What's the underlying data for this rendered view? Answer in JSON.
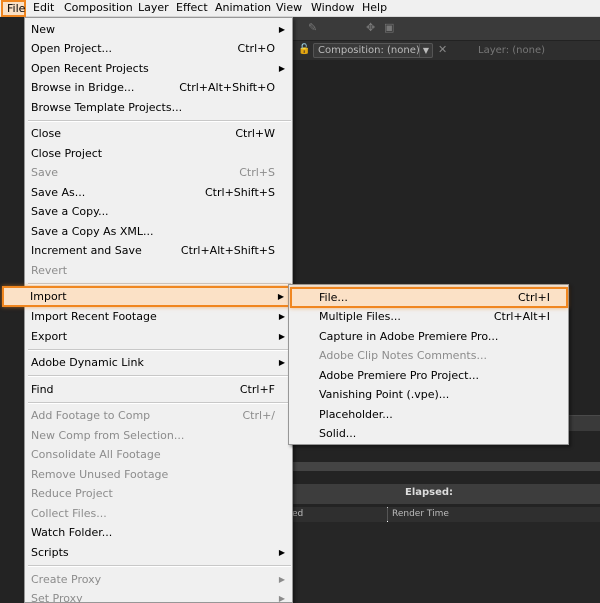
{
  "menubar": {
    "items": [
      "File",
      "Edit",
      "Composition",
      "Layer",
      "Effect",
      "Animation",
      "View",
      "Window",
      "Help"
    ]
  },
  "background": {
    "composition_tab": "Composition: (none)",
    "layer_tab": "Layer: (none)",
    "render_elapsed": "Elapsed:",
    "render_col_1": "ed",
    "render_col_2": "Render Time"
  },
  "file_menu": {
    "items": [
      {
        "label": "New",
        "shortcut": "",
        "submenu": true,
        "disabled": false
      },
      {
        "label": "Open Project...",
        "shortcut": "Ctrl+O",
        "submenu": false,
        "disabled": false
      },
      {
        "label": "Open Recent Projects",
        "shortcut": "",
        "submenu": true,
        "disabled": false
      },
      {
        "label": "Browse in Bridge...",
        "shortcut": "Ctrl+Alt+Shift+O",
        "submenu": false,
        "disabled": false
      },
      {
        "label": "Browse Template Projects...",
        "shortcut": "",
        "submenu": false,
        "disabled": false
      },
      {
        "label": "Close",
        "shortcut": "Ctrl+W",
        "submenu": false,
        "disabled": false
      },
      {
        "label": "Close Project",
        "shortcut": "",
        "submenu": false,
        "disabled": false
      },
      {
        "label": "Save",
        "shortcut": "Ctrl+S",
        "submenu": false,
        "disabled": true
      },
      {
        "label": "Save As...",
        "shortcut": "Ctrl+Shift+S",
        "submenu": false,
        "disabled": false
      },
      {
        "label": "Save a Copy...",
        "shortcut": "",
        "submenu": false,
        "disabled": false
      },
      {
        "label": "Save a Copy As XML...",
        "shortcut": "",
        "submenu": false,
        "disabled": false
      },
      {
        "label": "Increment and Save",
        "shortcut": "Ctrl+Alt+Shift+S",
        "submenu": false,
        "disabled": false
      },
      {
        "label": "Revert",
        "shortcut": "",
        "submenu": false,
        "disabled": true
      },
      {
        "label": "Import",
        "shortcut": "",
        "submenu": true,
        "disabled": false
      },
      {
        "label": "Import Recent Footage",
        "shortcut": "",
        "submenu": true,
        "disabled": false
      },
      {
        "label": "Export",
        "shortcut": "",
        "submenu": true,
        "disabled": false
      },
      {
        "label": "Adobe Dynamic Link",
        "shortcut": "",
        "submenu": true,
        "disabled": false
      },
      {
        "label": "Find",
        "shortcut": "Ctrl+F",
        "submenu": false,
        "disabled": false
      },
      {
        "label": "Add Footage to Comp",
        "shortcut": "Ctrl+/",
        "submenu": false,
        "disabled": true
      },
      {
        "label": "New Comp from Selection...",
        "shortcut": "",
        "submenu": false,
        "disabled": true
      },
      {
        "label": "Consolidate All Footage",
        "shortcut": "",
        "submenu": false,
        "disabled": true
      },
      {
        "label": "Remove Unused Footage",
        "shortcut": "",
        "submenu": false,
        "disabled": true
      },
      {
        "label": "Reduce Project",
        "shortcut": "",
        "submenu": false,
        "disabled": true
      },
      {
        "label": "Collect Files...",
        "shortcut": "",
        "submenu": false,
        "disabled": true
      },
      {
        "label": "Watch Folder...",
        "shortcut": "",
        "submenu": false,
        "disabled": false
      },
      {
        "label": "Scripts",
        "shortcut": "",
        "submenu": true,
        "disabled": false
      },
      {
        "label": "Create Proxy",
        "shortcut": "",
        "submenu": true,
        "disabled": true
      },
      {
        "label": "Set Proxy",
        "shortcut": "",
        "submenu": true,
        "disabled": true
      }
    ]
  },
  "import_submenu": {
    "items": [
      {
        "label": "File...",
        "shortcut": "Ctrl+I",
        "disabled": false
      },
      {
        "label": "Multiple Files...",
        "shortcut": "Ctrl+Alt+I",
        "disabled": false
      },
      {
        "label": "Capture in Adobe Premiere Pro...",
        "shortcut": "",
        "disabled": false
      },
      {
        "label": "Adobe Clip Notes Comments...",
        "shortcut": "",
        "disabled": true
      },
      {
        "label": "Adobe Premiere Pro Project...",
        "shortcut": "",
        "disabled": false
      },
      {
        "label": "Vanishing Point (.vpe)...",
        "shortcut": "",
        "disabled": false
      },
      {
        "label": "Placeholder...",
        "shortcut": "",
        "disabled": false
      },
      {
        "label": "Solid...",
        "shortcut": "",
        "disabled": false
      }
    ]
  },
  "colors": {
    "highlight_border": "#f0861f",
    "highlight_fill": "#fbe1c6",
    "menu_bg": "#f0f0f0",
    "disabled_text": "#8c8c8c",
    "app_bg": "#232323"
  },
  "icons": {
    "submenu_arrow": "arrow-right-icon",
    "lock": "lock-icon",
    "close": "close-icon",
    "dropdown": "chevron-down-icon"
  }
}
